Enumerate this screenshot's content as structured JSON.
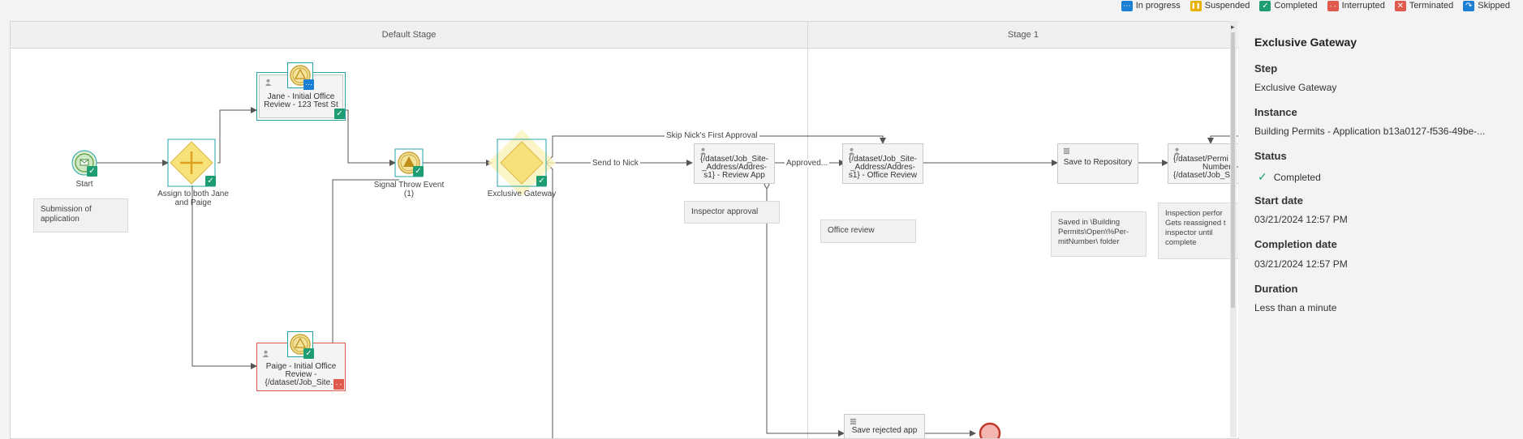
{
  "legend": [
    {
      "label": "In progress",
      "color": "#1b7fd4",
      "glyph": "⋯"
    },
    {
      "label": "Suspended",
      "color": "#e8b100",
      "glyph": "❚❚"
    },
    {
      "label": "Completed",
      "color": "#1e9c72",
      "glyph": "✓"
    },
    {
      "label": "Interrupted",
      "color": "#e05a4e",
      "glyph": "- -"
    },
    {
      "label": "Terminated",
      "color": "#e05a4e",
      "glyph": "✕"
    },
    {
      "label": "Skipped",
      "color": "#1b7fd4",
      "glyph": "↷"
    }
  ],
  "stages": [
    "Default Stage",
    "Stage 1"
  ],
  "nodes": {
    "start": "Start",
    "assign": "Assign to both Jane and Paige",
    "jane": "Jane - Initial Office Review - 123 Test St",
    "paige_line1": "Paige - Initial Office",
    "paige_line2": "Review -",
    "paige_line3": "{/dataset/Job_Site...",
    "signal": "Signal Throw Event (1)",
    "gateway": "Exclusive Gateway",
    "review_app_line1": "{/dataset/Job_Site-",
    "review_app_line2": "_Address/Addres-",
    "review_app_line3": "s1} - Review App",
    "office_line1": "{/dataset/Job_Site-",
    "office_line2": "_Address/Addres-",
    "office_line3": "s1} - Office Review",
    "save_repo": "Save to Repository",
    "permit_line1": "{/dataset/Permi",
    "permit_line2": "Number} -",
    "permit_line3": "{/dataset/Job_Si",
    "save_rejected": "Save rejected app"
  },
  "notes": {
    "submission": "Submission of application",
    "inspector": "Inspector approval",
    "office_review": "Office review",
    "saved_in": "Saved in \\Building Permits\\Open\\%Per-mitNumber\\ folder",
    "inspection": "Inspection perfor Gets reassigned t inspector until complete"
  },
  "flow_labels": {
    "skip": "Skip Nick's First Approval",
    "send": "Send to Nick",
    "approved": "Approved..."
  },
  "panel": {
    "title": "Exclusive Gateway",
    "step_label": "Step",
    "step_value": "Exclusive Gateway",
    "instance_label": "Instance",
    "instance_value": "Building Permits - Application b13a0127-f536-49be-...",
    "status_label": "Status",
    "status_value": "Completed",
    "start_label": "Start date",
    "start_value": "03/21/2024 12:57 PM",
    "completion_label": "Completion date",
    "completion_value": "03/21/2024 12:57 PM",
    "duration_label": "Duration",
    "duration_value": "Less than a minute"
  },
  "colors": {
    "completed": "#1e9c72",
    "interrupted": "#e05a4e",
    "selection": "#26a3a8",
    "gateway": "#f7e27a"
  }
}
